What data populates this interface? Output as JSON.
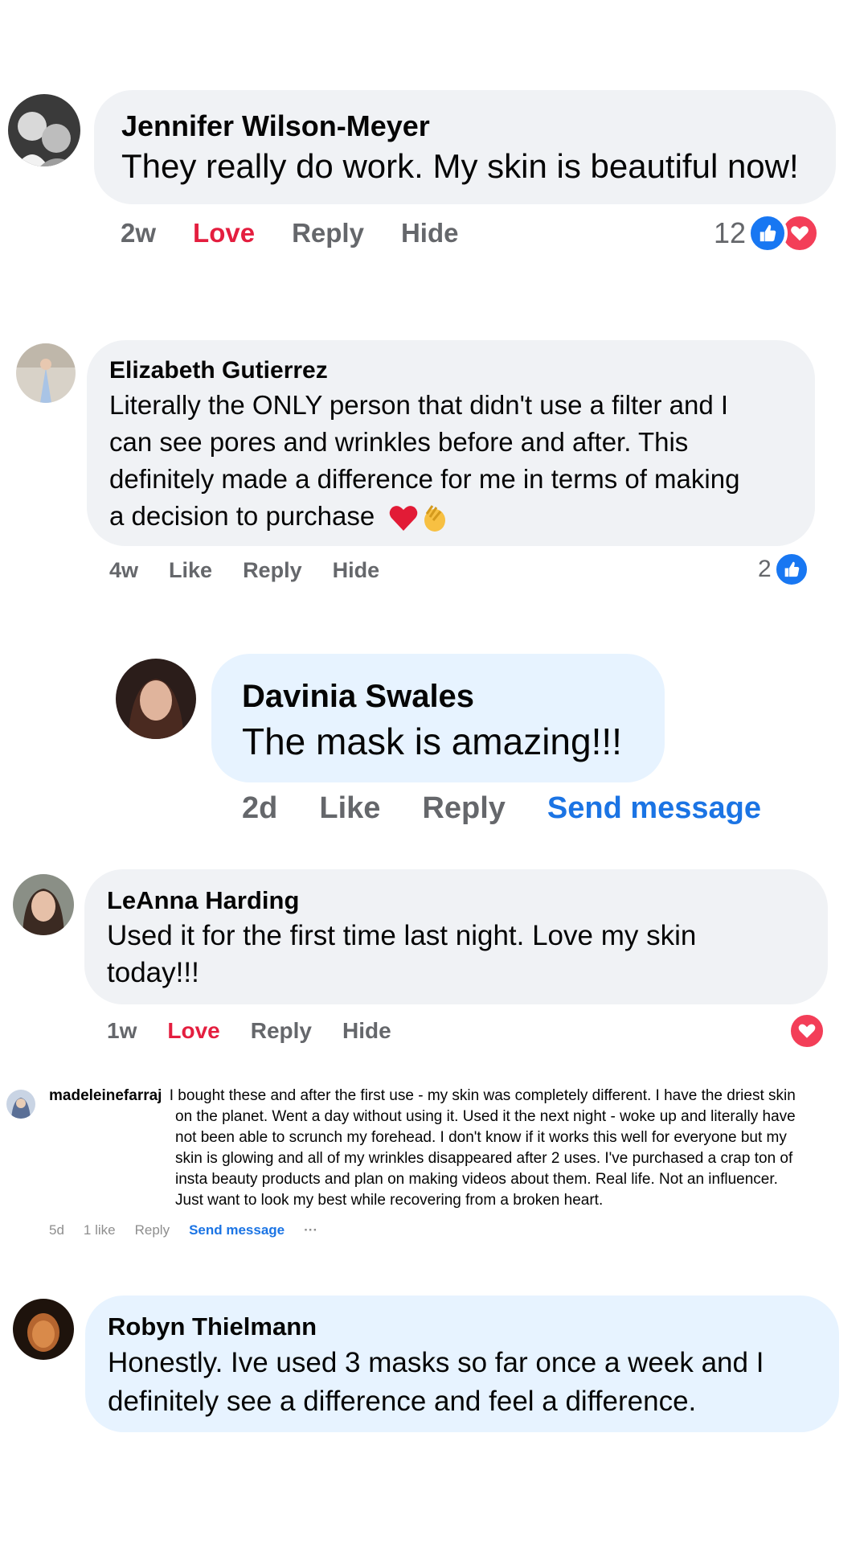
{
  "comments": [
    {
      "name": "Jennifer Wilson-Meyer",
      "text": "They really do work. My skin is beautiful now!",
      "time": "2w",
      "reaction": "Love",
      "reply": "Reply",
      "hide": "Hide",
      "count": "12",
      "reactions": [
        "like-icon",
        "heart-icon"
      ]
    },
    {
      "name": "Elizabeth Gutierrez",
      "text_lines": [
        "Literally the ONLY person that didn't use a filter and I",
        "can see pores and wrinkles before and after. This",
        "definitely made a difference for me in terms of making",
        "a decision to purchase"
      ],
      "emoji": [
        "red-heart-emoji",
        "clapping-hands-emoji"
      ],
      "time": "4w",
      "reaction": "Like",
      "reply": "Reply",
      "hide": "Hide",
      "count": "2",
      "reactions": [
        "like-icon"
      ]
    },
    {
      "name": "Davinia Swales",
      "text": "The mask is amazing!!!",
      "time": "2d",
      "reaction": "Like",
      "reply": "Reply",
      "send": "Send message"
    },
    {
      "name": "LeAnna Harding",
      "text_lines": [
        "Used it for the first time last night. Love my skin",
        "today!!!"
      ],
      "time": "1w",
      "reaction": "Love",
      "reply": "Reply",
      "hide": "Hide",
      "reactions": [
        "heart-icon"
      ]
    },
    {
      "name": "madeleinefarraj",
      "text_lines": [
        "I bought these and after the first use - my skin was completely different. I have the driest skin",
        "on the planet. Went a day without using it. Used it the next night - woke up and literally have",
        "not been able to scrunch my forehead. I don't know if it works this well for everyone but my",
        "skin is glowing and all of my wrinkles disappeared after 2 uses. I've purchased a crap ton of",
        "insta beauty products and plan on making videos about them. Real life. Not an influencer.",
        "Just want to look my best while recovering from a broken heart."
      ],
      "time": "5d",
      "likes": "1 like",
      "reply": "Reply",
      "send": "Send message",
      "more": "···"
    },
    {
      "name": "Robyn Thielmann",
      "text_lines": [
        "Honestly. Ive used 3 masks so far once a week and I",
        "definitely see a difference and feel a difference."
      ]
    }
  ],
  "colors": {
    "bubble_gray": "#f0f2f5",
    "bubble_blue": "#e7f3ff",
    "love_red": "#e41e3f",
    "link_blue": "#1b74e4",
    "meta_gray": "#65676b"
  }
}
